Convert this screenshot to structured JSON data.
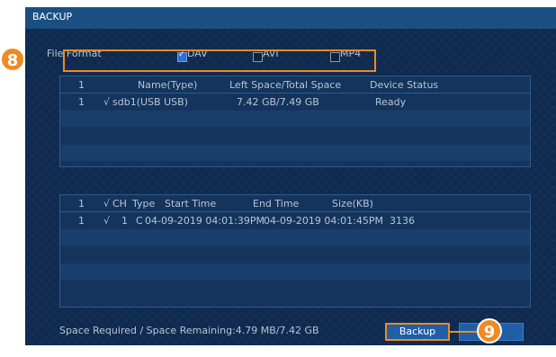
{
  "window": {
    "title": "BACKUP"
  },
  "file_format": {
    "label": "File Format",
    "options": [
      {
        "label": "DAV",
        "checked": true
      },
      {
        "label": "AVI",
        "checked": false
      },
      {
        "label": "MP4",
        "checked": false
      }
    ]
  },
  "device_table": {
    "columns": [
      "1",
      "Name(Type)",
      "Left Space/Total Space",
      "Device Status"
    ],
    "rows": [
      {
        "index": "1",
        "check": "√",
        "name": "sdb1(USB USB)",
        "space": "7.42 GB/7.49 GB",
        "status": "Ready"
      }
    ]
  },
  "file_table": {
    "columns": [
      "1",
      "√",
      "CH",
      "Type",
      "Start Time",
      "End Time",
      "Size(KB)"
    ],
    "rows": [
      {
        "index": "1",
        "check": "√",
        "ch": "1",
        "type": "C",
        "start": "04-09-2019 04:01:39PM",
        "end": "04-09-2019 04:01:45PM",
        "size": "3136"
      }
    ]
  },
  "footer": {
    "space_required": "Space Required / Space Remaining:4.79 MB/7.42 GB",
    "backup_label": "Backup"
  },
  "callouts": {
    "format": "8",
    "backup": "9"
  },
  "colors": {
    "callout": "#f08a20",
    "titlebar": "#1a4f82",
    "background": "#0f2a4e"
  }
}
